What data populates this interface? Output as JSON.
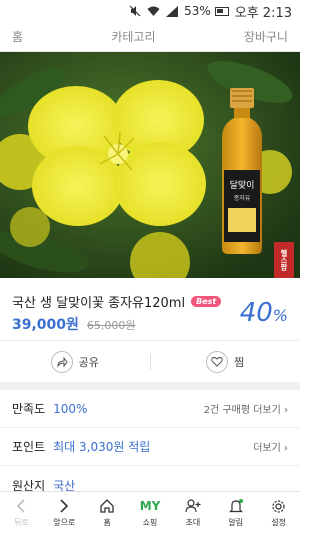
{
  "status_bar": {
    "battery": "53%",
    "time": "오후 2:13"
  },
  "top_nav": {
    "home": "홈",
    "category": "카테고리",
    "cart": "장바구니"
  },
  "product": {
    "title": "국산 생 달맞이꽃 종자유120ml",
    "badge": "Best",
    "price": "39,000원",
    "original_price": "65,000원",
    "discount": "40",
    "discount_unit": "%",
    "image_brand_text": "헬스팜"
  },
  "actions": {
    "share": "공유",
    "like": "찜"
  },
  "details": {
    "satisfaction_label": "만족도",
    "satisfaction_value": "100%",
    "reviews": "2건 구매평 더보기",
    "points_label": "포인트",
    "points_value": "최대 3,030원 적립",
    "points_more": "더보기",
    "origin_label": "원산지",
    "origin_value": "국산"
  },
  "bottom_nav": {
    "back": "뒤로",
    "forward": "앞으로",
    "home": "홈",
    "my": "MY",
    "shopping": "쇼핑",
    "invite": "초대",
    "alarm": "알림",
    "settings": "설정"
  },
  "colors": {
    "accent_blue": "#3b6fd0",
    "badge_pink": "#f2567a",
    "my_green": "#2fa84f"
  }
}
